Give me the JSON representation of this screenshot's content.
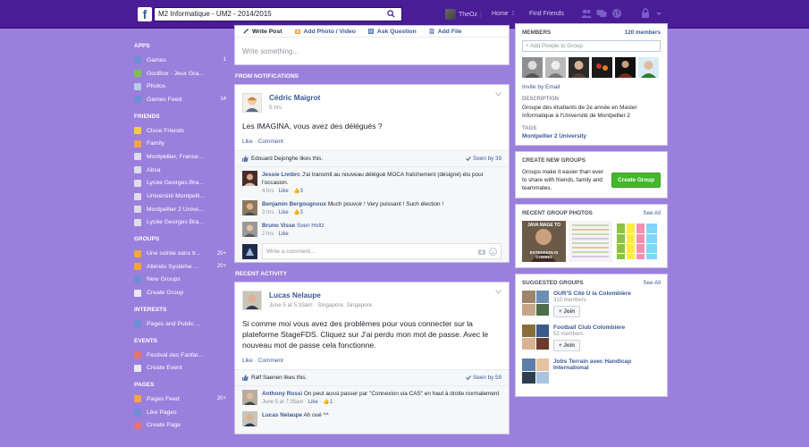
{
  "topbar": {
    "logo": "f",
    "search_value": "M2 Informatique - UM2 - 2014/2015",
    "user_name": "TheOz",
    "home": "Home",
    "home_count": "1",
    "find_friends": "Find Friends"
  },
  "leftnav": {
    "apps_head": "APPS",
    "apps": [
      {
        "label": "Games",
        "count": "1",
        "color": "#6d8fd9"
      },
      {
        "label": "GooBox - Jeux Gra...",
        "count": "",
        "color": "#7cc24a"
      },
      {
        "label": "Photos",
        "count": "",
        "color": "#b8cce8"
      },
      {
        "label": "Games Feed",
        "count": "14",
        "color": "#6d8fd9"
      }
    ],
    "friends_head": "FRIENDS",
    "friends": [
      {
        "label": "Close Friends",
        "color": "#f7c94a"
      },
      {
        "label": "Family",
        "color": "#f2a541"
      },
      {
        "label": "Montpellier, France...",
        "color": "#e0dde8"
      },
      {
        "label": "Absa",
        "color": "#e0dde8"
      },
      {
        "label": "Lycée Georges Bra...",
        "color": "#e0dde8"
      },
      {
        "label": "Université Montpelli...",
        "color": "#e0dde8"
      },
      {
        "label": "Montpellier 2 Unive...",
        "color": "#e0dde8"
      },
      {
        "label": "Lycée Georges Bra...",
        "color": "#e0dde8"
      }
    ],
    "groups_head": "GROUPS",
    "groups": [
      {
        "label": "Une soirée sans tr...",
        "count": "20+",
        "color": "#f2a541"
      },
      {
        "label": "Aliénés Système ...",
        "count": "20+",
        "color": "#f2a541"
      },
      {
        "label": "New Groups",
        "count": "",
        "color": "#6d8fd9"
      },
      {
        "label": "Create Group",
        "count": "",
        "color": "#e8eaf5"
      }
    ],
    "interests_head": "INTERESTS",
    "interests": [
      {
        "label": "Pages and Public ...",
        "color": "#6d8fd9"
      }
    ],
    "events_head": "EVENTS",
    "events": [
      {
        "label": "Festival des Fanfar...",
        "color": "#e57373"
      },
      {
        "label": "Create Event",
        "color": "#e8eaf5"
      }
    ],
    "pages_head": "PAGES",
    "pages": [
      {
        "label": "Pages Feed",
        "count": "20+",
        "color": "#f2a541"
      },
      {
        "label": "Like Pages",
        "count": "",
        "color": "#6d8fd9"
      },
      {
        "label": "Create Page",
        "count": "",
        "color": "#e57373"
      }
    ]
  },
  "composer": {
    "tabs": [
      "Write Post",
      "Add Photo / Video",
      "Ask Question",
      "Add File"
    ],
    "placeholder": "Write something..."
  },
  "sections": {
    "from_notifications": "FROM NOTIFICATIONS",
    "recent_activity": "RECENT ACTIVITY"
  },
  "post1": {
    "author": "Cédric Maigrot",
    "time": "5 hrs",
    "text": "Les IMAGINA, vous avez des délégués ?",
    "like": "Like",
    "comment": "Comment",
    "likes_text": "Edouard Dejonghe likes this.",
    "seen": "Seen by 39",
    "comments": [
      {
        "name": "Jessie Lnnbrc",
        "text": "J'ai transmit au nouveau délégué MOCA fraîchement (désigné) élu pour l'occasion.",
        "time": "4 hrs",
        "like": "Like",
        "count": "3"
      },
      {
        "name": "Benjamin Bergougnoux",
        "text": "Much pouvoir ! Very puissant ! Such élection !",
        "time": "3 hrs",
        "like": "Like",
        "count": "3"
      },
      {
        "name": "Bruno Visse",
        "text": "Sven Holtz",
        "time": "2 hrs",
        "like": "Like",
        "count": ""
      }
    ],
    "comment_placeholder": "Write a comment..."
  },
  "post2": {
    "author": "Lucas Nelaupe",
    "time": "June 5 at 5:33am · Singapore, Singapore",
    "text": "Si comme moi vous avez des problèmes pour vous connecter sur la plateforme StageFDS. Cliquez sur J'ai perdu mon mot de passe. Avec le nouveau mot de passe cela fonctionne.",
    "like": "Like",
    "comment": "Comment",
    "likes_text": "Ralf Saenen likes this.",
    "seen": "Seen by 59",
    "comments": [
      {
        "name": "Anthony Rossi",
        "text": "On peut aussi passer par \"Connexion via CAS\" en haut à droite normalement",
        "time": "June 5 at 7:35am",
        "like": "Like",
        "count": "1"
      },
      {
        "name": "Lucas Nelaupe",
        "text": "Ah oué ^^",
        "time": "",
        "like": "",
        "count": ""
      }
    ]
  },
  "right": {
    "members_head": "MEMBERS",
    "members_count": "120 members",
    "add_people": "+ Add People to Group",
    "invite": "Invite by Email",
    "description_label": "DESCRIPTION",
    "description": "Groupe des étudiants de 2e année en Master Informatique à l'Université de Montpellier 2",
    "tags_label": "TAGS",
    "tag": "Montpellier 2 University",
    "create_head": "CREATE NEW GROUPS",
    "create_text": "Groups make it easier than ever to share with friends, family and teammates.",
    "create_btn": "Create Group",
    "photos_head": "RECENT GROUP PHOTOS",
    "see_all": "See All",
    "photo_meme_top": "JAVA MAGE TO",
    "photo_meme_bottom": "EXTENSION IS COMING",
    "suggested_head": "SUGGESTED GROUPS",
    "suggested": [
      {
        "name": "OUR'S Cité U la Colombière",
        "count": "310 members",
        "join": "Join"
      },
      {
        "name": "Football Club Colombière",
        "count": "52 members",
        "join": "Join"
      },
      {
        "name": "Jobs Terrain avec Handicap International",
        "count": "",
        "join": ""
      }
    ]
  }
}
